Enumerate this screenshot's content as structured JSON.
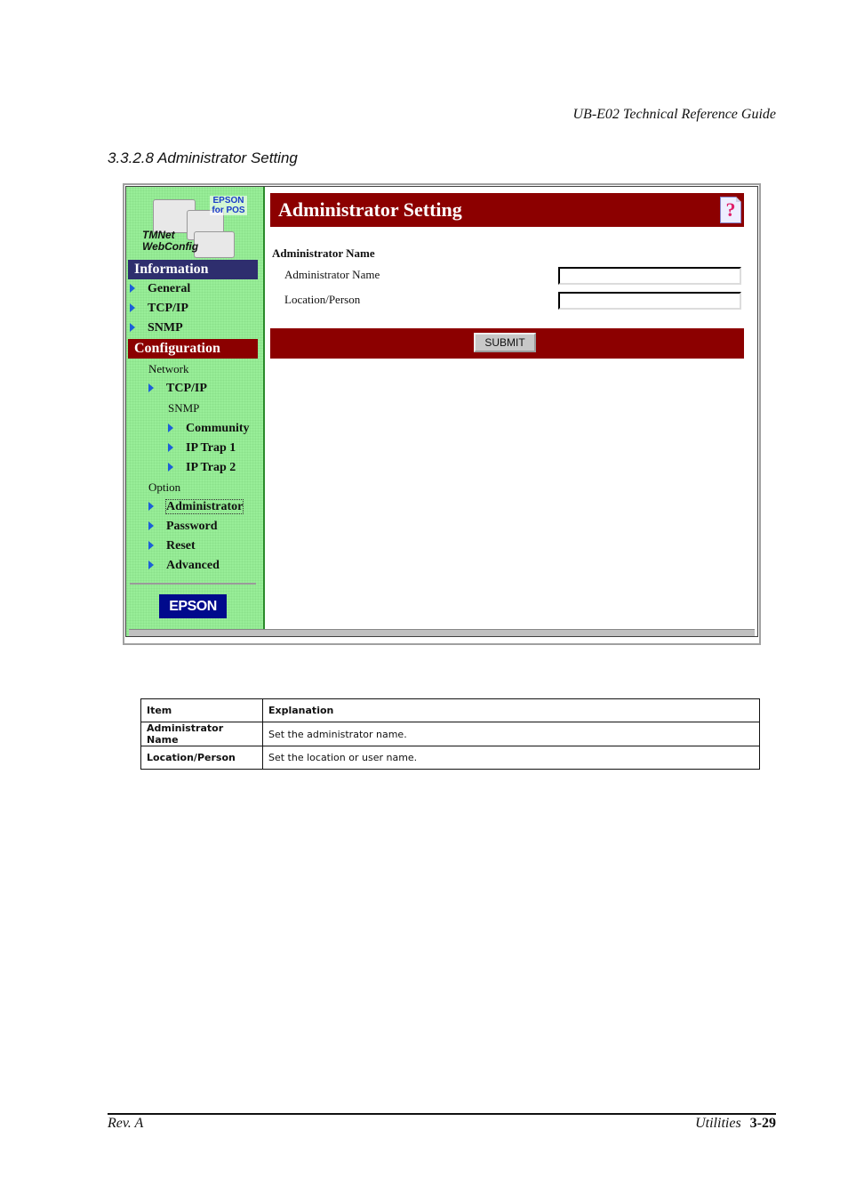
{
  "header": {
    "doc_title": "UB-E02 Technical Reference Guide"
  },
  "section": {
    "title": "3.3.2.8 Administrator Setting"
  },
  "screenshot": {
    "logo": {
      "brand_line": "EPSON for POS",
      "product_line": "TMNet WebConfig"
    },
    "sidebar": {
      "information_heading": "Information",
      "information_items": [
        "General",
        "TCP/IP",
        "SNMP"
      ],
      "configuration_heading": "Configuration",
      "network_label": "Network",
      "network_items": [
        "TCP/IP"
      ],
      "snmp_label": "SNMP",
      "snmp_items": [
        "Community",
        "IP Trap 1",
        "IP Trap 2"
      ],
      "option_label": "Option",
      "option_items": [
        "Administrator",
        "Password",
        "Reset",
        "Advanced"
      ],
      "footer_logo": "EPSON"
    },
    "main": {
      "page_title": "Administrator Setting",
      "help_icon": "?",
      "group_label": "Administrator Name",
      "fields": [
        {
          "label": "Administrator Name",
          "value": ""
        },
        {
          "label": "Location/Person",
          "value": ""
        }
      ],
      "submit_label": "SUBMIT"
    },
    "colors": {
      "sidebar_bg": "#98ee98",
      "info_heading": "#2e2e6e",
      "accent_red": "#8c0000",
      "epson_blue": "#000a8c"
    }
  },
  "table": {
    "headers": [
      "Item",
      "Explanation"
    ],
    "rows": [
      [
        "Administrator Name",
        "Set the administrator name."
      ],
      [
        "Location/Person",
        "Set the location or user name."
      ]
    ]
  },
  "footer": {
    "revision": "Rev. A",
    "section": "Utilities",
    "page": "3-29"
  }
}
